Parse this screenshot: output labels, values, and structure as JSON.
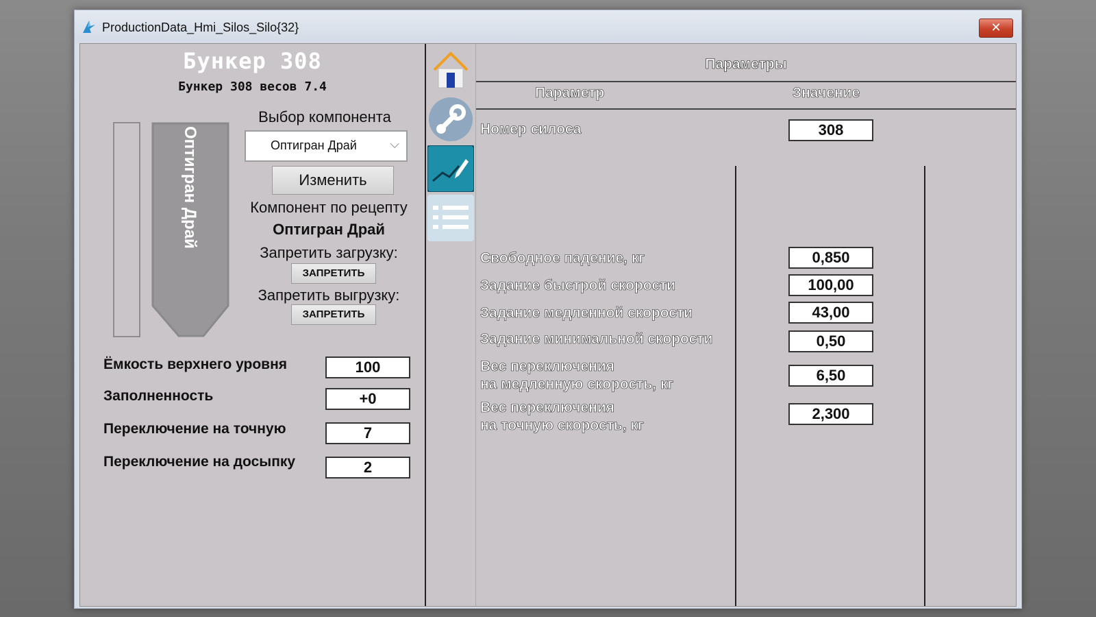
{
  "window": {
    "title": "ProductionData_Hmi_Silos_Silo{32}",
    "close_label": "✕"
  },
  "left": {
    "bunker_title": "Бункер 308",
    "bunker_subtitle": "Бункер 308 весов 7.4",
    "silo_label": "Оптигран Драй",
    "component_select_label": "Выбор компонента",
    "component_select_value": "Оптигран Драй",
    "change_button": "Изменить",
    "recipe_component_label": "Компонент по рецепту",
    "recipe_component_value": "Оптигран Драй",
    "forbid_load_label": "Запретить загрузку:",
    "forbid_load_button": "ЗАПРЕТИТЬ",
    "forbid_unload_label": "Запретить выгрузку:",
    "forbid_unload_button": "ЗАПРЕТИТЬ",
    "fields": [
      {
        "label": "Ёмкость верхнего уровня",
        "value": "100"
      },
      {
        "label": "Заполненность",
        "value": "+0"
      },
      {
        "label": "Переключение на точную",
        "value": "7"
      },
      {
        "label": "Переключение на досыпку",
        "value": "2"
      }
    ]
  },
  "nav": {
    "icons": [
      "home-icon",
      "wrench-icon",
      "chart-edit-icon",
      "list-icon"
    ]
  },
  "right": {
    "title": "Параметры",
    "col_param": "Параметр",
    "col_value": "Значение",
    "silo_number_label": "Номер силоса",
    "silo_number_value": "308",
    "params": [
      {
        "label": "Свободное падение, кг",
        "value": "0,850"
      },
      {
        "label": "Задание быстрой скорости",
        "value": "100,00"
      },
      {
        "label": "Задание медленной скорости",
        "value": "43,00"
      },
      {
        "label": "Задание минимальной скорости",
        "value": "0,50"
      },
      {
        "label_line1": "Вес переключения",
        "label_line2": "на медленную скорость, кг",
        "value": "6,50"
      },
      {
        "label_line1": "Вес переключения",
        "label_line2": "на точную скорость, кг",
        "value": "2,300"
      }
    ]
  },
  "colors": {
    "accent_nav": "#1e8fa8",
    "panel": "#c9c5c8",
    "close": "#c8422a"
  }
}
